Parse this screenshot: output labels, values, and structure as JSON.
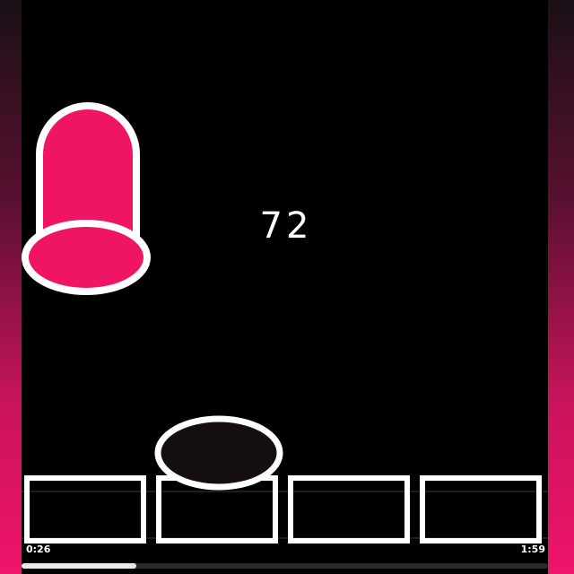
{
  "game": {
    "score": "72",
    "accent_color": "#f01464",
    "ball_color": "#140e10",
    "tile_count": 4
  },
  "video": {
    "elapsed": "0:26",
    "duration": "1:59",
    "progress": 0.218
  }
}
